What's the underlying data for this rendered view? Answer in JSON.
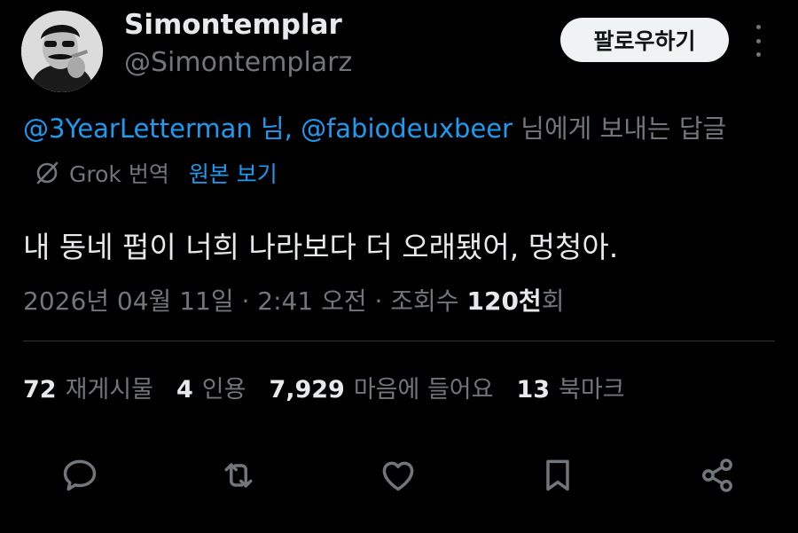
{
  "author": {
    "display_name": "Simontemplar",
    "handle": "@Simontemplarz"
  },
  "follow_button_label": "팔로우하기",
  "reply_context": {
    "user1": "@3YearLetterman 님,",
    "user2": "@fabiodeuxbeer",
    "suffix": " 님에게 보내는 답글"
  },
  "translation": {
    "label": "Grok 번역",
    "show_original": "원본 보기"
  },
  "tweet_text": "내 동네 펍이 너희 나라보다 더 오래됐어, 멍청아.",
  "meta": {
    "timestamp": "2026년 04월 11일 · 2:41 오전 · 조회수 ",
    "views": "120천",
    "views_suffix": "회"
  },
  "stats": {
    "reposts": {
      "count": "72",
      "label": "재게시물"
    },
    "quotes": {
      "count": "4",
      "label": "인용"
    },
    "likes": {
      "count": "7,929",
      "label": "마음에 들어요"
    },
    "bookmarks": {
      "count": "13",
      "label": "북마크"
    }
  },
  "actions": [
    "reply-icon",
    "repost-icon",
    "like-icon",
    "bookmark-icon",
    "share-icon"
  ],
  "colors": {
    "background": "#000000",
    "primary_text": "#e7e9ea",
    "secondary_text": "#71767b",
    "link": "#1d9bf0",
    "follow_button_bg": "#eff3f4",
    "divider": "#2f3336"
  }
}
